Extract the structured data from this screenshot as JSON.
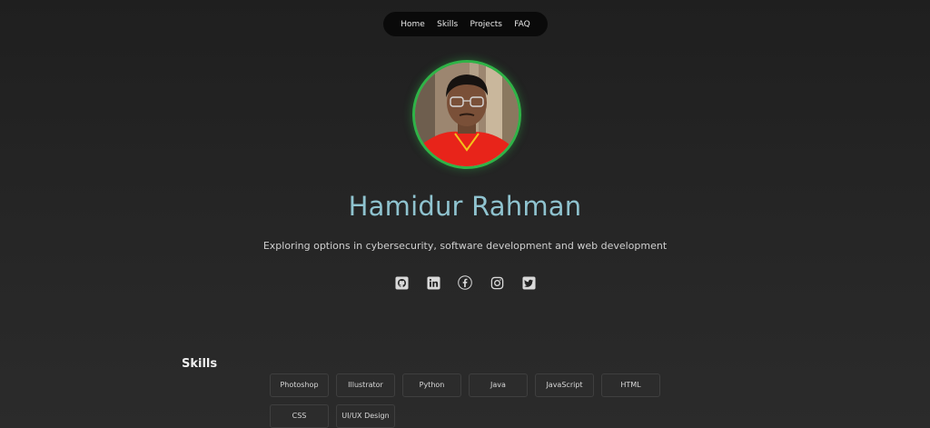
{
  "nav": {
    "items": [
      {
        "label": "Home"
      },
      {
        "label": "Skills"
      },
      {
        "label": "Projects"
      },
      {
        "label": "FAQ"
      }
    ]
  },
  "profile": {
    "name": "Hamidur Rahman",
    "tagline": "Exploring options in cybersecurity, software development and web development",
    "avatar_ring_color": "#2fb347"
  },
  "socials": [
    {
      "icon": "github-icon"
    },
    {
      "icon": "linkedin-icon"
    },
    {
      "icon": "facebook-icon"
    },
    {
      "icon": "instagram-icon"
    },
    {
      "icon": "twitter-icon"
    }
  ],
  "skills": {
    "title": "Skills",
    "items": [
      "Photoshop",
      "Illustrator",
      "Python",
      "Java",
      "JavaScript",
      "HTML",
      "CSS",
      "UI/UX Design"
    ]
  },
  "colors": {
    "name": "#8fc3cf",
    "background": "#242424",
    "nav_bg": "#0a0a0a"
  }
}
